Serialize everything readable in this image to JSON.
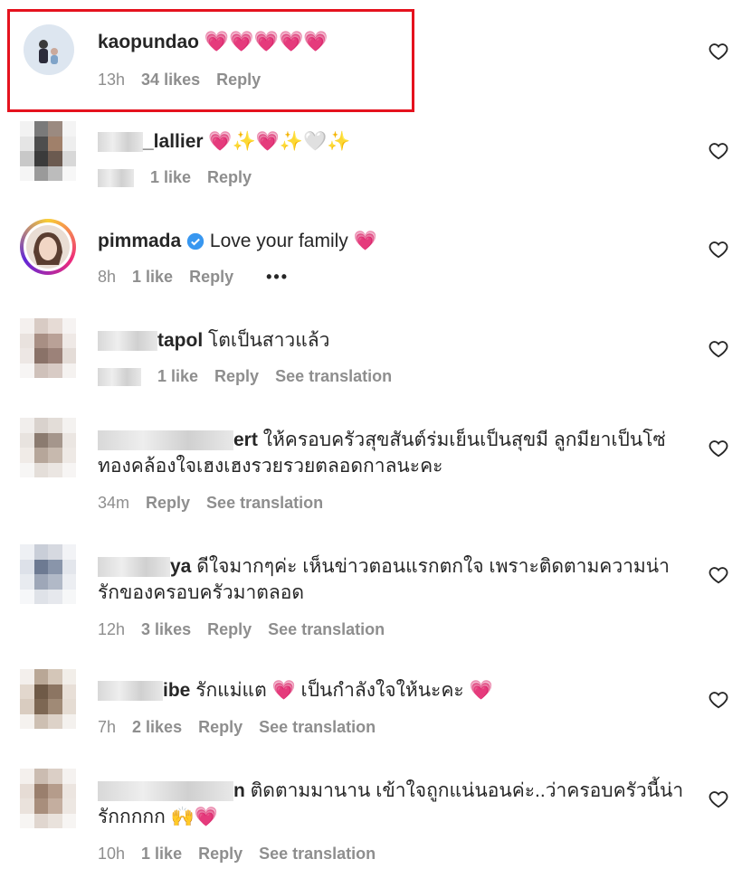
{
  "comments": [
    {
      "username": "kaopundao",
      "text": "💗💗💗💗💗",
      "time": "13h",
      "likes": "34 likes",
      "reply": "Reply"
    },
    {
      "username": "_lallier",
      "text": "💗✨💗✨🤍✨",
      "time": "",
      "likes": "1 like",
      "reply": "Reply"
    },
    {
      "username": "pimmada",
      "text": "Love your family 💗",
      "time": "8h",
      "likes": "1 like",
      "reply": "Reply",
      "more": "•••"
    },
    {
      "username": "tapol",
      "text": "โตเป็นสาวแล้ว",
      "time": "",
      "likes": "1 like",
      "reply": "Reply",
      "translation": "See translation"
    },
    {
      "username": "ert",
      "text": "ให้ครอบครัวสุขสันต์ร่มเย็นเป็นสุขมี ลูกมียาเป็นโซ่",
      "text2": "ทองคล้องใจเฮงเฮงรวยรวยตลอดกาลนะคะ",
      "time": "34m",
      "likes": "",
      "reply": "Reply",
      "translation": "See translation"
    },
    {
      "username": "ya",
      "text": "ดีใจมากๆค่ะ เห็นข่าวตอนแรกตกใจ เพราะติดตามความน่า",
      "text2": "รักของครอบครัวมาตลอด",
      "time": "12h",
      "likes": "3 likes",
      "reply": "Reply",
      "translation": "See translation"
    },
    {
      "username": "ibe",
      "text": "รักแม่แต 💗 เป็นกำลังใจให้นะคะ 💗",
      "time": "7h",
      "likes": "2 likes",
      "reply": "Reply",
      "translation": "See translation"
    },
    {
      "username": "n",
      "text": "ติดตามมานาน เข้าใจถูกแน่นอนค่ะ..ว่าครอบครัวนี้น่า",
      "text2": "รักกกกก 🙌💗",
      "time": "10h",
      "likes": "1 like",
      "reply": "Reply",
      "translation": "See translation"
    }
  ],
  "colors": {
    "accent_red": "#e5121e",
    "heart": "#e8356b",
    "verified": "#3897f0",
    "meta": "#8e8e8e"
  }
}
